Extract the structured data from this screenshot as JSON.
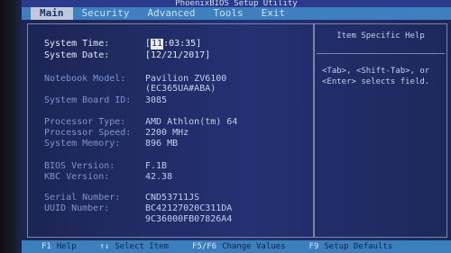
{
  "window": {
    "title": "PhoenixBIOS Setup Utility"
  },
  "menu": {
    "items": [
      {
        "label": "Main"
      },
      {
        "label": "Security"
      },
      {
        "label": "Advanced"
      },
      {
        "label": "Tools"
      },
      {
        "label": "Exit"
      }
    ]
  },
  "system": {
    "time_label": "System Time:",
    "time_cursor": "11",
    "time_rest": ":03:35",
    "date_label": "System Date:",
    "date_value": "12/21/2017",
    "model_label": "Notebook Model:",
    "model_value": "Pavilion ZV6100",
    "model_sub": "(EC365UA#ABA)",
    "board_label": "System Board ID:",
    "board_value": "3085",
    "proc_type_label": "Processor Type:",
    "proc_type_value": "AMD Athlon(tm) 64",
    "proc_speed_label": "Processor Speed:",
    "proc_speed_value": "2200 MHz",
    "memory_label": "System Memory:",
    "memory_value": "896 MB",
    "bios_label": "BIOS Version:",
    "bios_value": "F.1B",
    "kbc_label": "KBC Version:",
    "kbc_value": "42.38",
    "serial_label": "Serial Number:",
    "serial_value": "CND53711JS",
    "uuid_label": "UUID Number:",
    "uuid_line1": "BC42127020C311DA",
    "uuid_line2": "9C36000FB07826A4"
  },
  "help": {
    "title": "Item Specific Help",
    "text": "<Tab>, <Shift-Tab>, or\n<Enter> selects field."
  },
  "footer": {
    "items": [
      {
        "key": "F1",
        "desc": "Help"
      },
      {
        "key": "↑↓",
        "desc": "Select Item"
      },
      {
        "key": "F5/F6",
        "desc": "Change Values"
      },
      {
        "key": "F9",
        "desc": "Setup Defaults"
      }
    ]
  },
  "colors": {
    "background": "#243173",
    "menu_bar": "#3d7fbf",
    "label": "#7e93d6",
    "value": "#c6cdeb",
    "highlight": "#e9ecf4"
  }
}
